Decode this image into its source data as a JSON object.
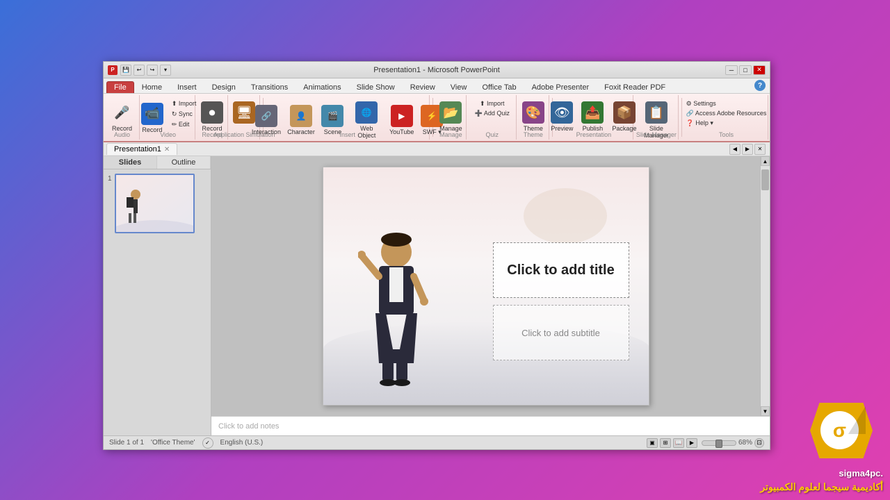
{
  "app": {
    "title": "Presentation1 - Microsoft PowerPoint",
    "window_controls": {
      "minimize": "─",
      "maximize": "□",
      "close": "✕"
    }
  },
  "ribbon": {
    "tabs": [
      {
        "id": "file",
        "label": "File",
        "active": true,
        "color": "red"
      },
      {
        "id": "home",
        "label": "Home"
      },
      {
        "id": "insert",
        "label": "Insert"
      },
      {
        "id": "design",
        "label": "Design"
      },
      {
        "id": "transitions",
        "label": "Transitions"
      },
      {
        "id": "animations",
        "label": "Animations"
      },
      {
        "id": "slideshow",
        "label": "Slide Show"
      },
      {
        "id": "review",
        "label": "Review"
      },
      {
        "id": "view",
        "label": "View"
      },
      {
        "id": "officetab",
        "label": "Office Tab"
      },
      {
        "id": "adobe",
        "label": "Adobe Presenter"
      },
      {
        "id": "foxit",
        "label": "Foxit Reader PDF"
      }
    ],
    "groups": {
      "audio": {
        "label": "Audio",
        "buttons": [
          {
            "icon": "🎤",
            "label": "Record",
            "type": "large",
            "color": "red-mic"
          }
        ]
      },
      "video": {
        "label": "Video",
        "buttons": [
          {
            "icon": "📹",
            "label": "Record",
            "type": "large"
          },
          {
            "icon": "↻",
            "label": "Sync"
          },
          {
            "icon": "✏",
            "label": "Edit"
          }
        ]
      },
      "record": {
        "label": "Record"
      },
      "appsim": {
        "label": "Application Simulation"
      },
      "interaction": {
        "label": "Interaction"
      },
      "insert": {
        "label": "Insert",
        "buttons": [
          {
            "icon": "👤",
            "label": "Character"
          },
          {
            "icon": "🎬",
            "label": "Scene"
          },
          {
            "icon": "🌐",
            "label": "Web Object"
          },
          {
            "icon": "▶",
            "label": "YouTube"
          },
          {
            "icon": "🎞",
            "label": "SWF"
          }
        ]
      },
      "manage": {
        "label": "Manage"
      },
      "quiz": {
        "label": "Quiz",
        "buttons": [
          {
            "icon": "📋",
            "label": "Import"
          },
          {
            "icon": "➕",
            "label": "Add Quiz"
          }
        ]
      },
      "theme": {
        "label": "Theme",
        "buttons": [
          {
            "icon": "🎨",
            "label": "Theme"
          }
        ]
      },
      "presentation": {
        "label": "Presentation",
        "buttons": [
          {
            "icon": "👁",
            "label": "Preview"
          },
          {
            "icon": "📤",
            "label": "Publish"
          },
          {
            "icon": "📦",
            "label": "Package"
          }
        ]
      },
      "slidemanager": {
        "label": "Slide Manager"
      },
      "tools": {
        "label": "Tools",
        "buttons": [
          {
            "label": "Settings"
          },
          {
            "label": "Access Adobe Resources"
          },
          {
            "label": "Help"
          }
        ]
      }
    }
  },
  "document_tab": {
    "name": "Presentation1",
    "close_icon": "✕"
  },
  "slide_panel": {
    "tabs": [
      {
        "label": "Slides",
        "active": true
      },
      {
        "label": "Outline"
      }
    ],
    "slides": [
      {
        "number": "1"
      }
    ]
  },
  "slide": {
    "title_placeholder": "Click to add title",
    "subtitle_placeholder": "Click to add subtitle",
    "notes_placeholder": "Click to add notes"
  },
  "status_bar": {
    "slide_info": "Slide 1 of 1",
    "theme": "'Office Theme'",
    "language": "English (U.S.)"
  },
  "watermark": {
    "text1": "sigma4pc.",
    "text2": "أكاديمية سيجما لعلوم الكمبيوتر"
  }
}
